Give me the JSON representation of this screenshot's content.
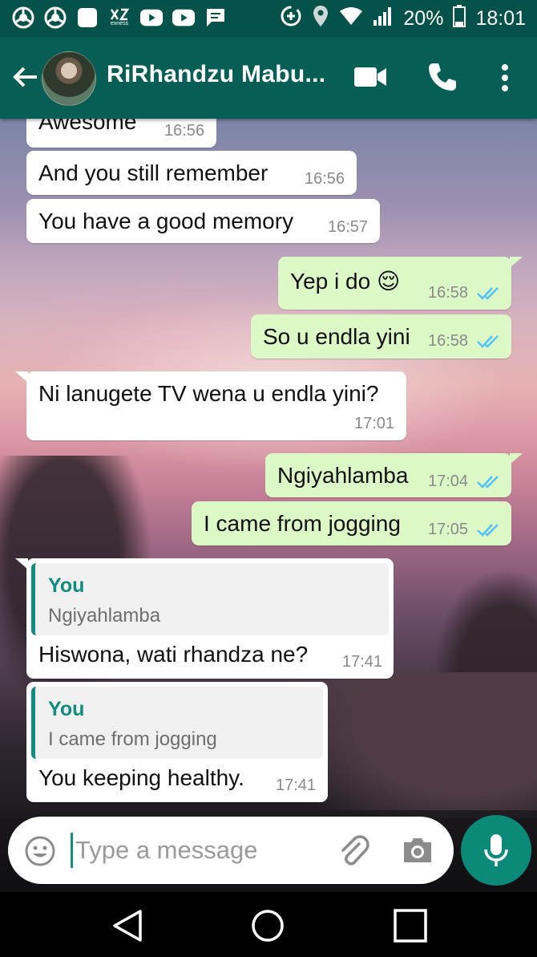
{
  "status_bar": {
    "battery": "20%",
    "time": "18:01",
    "left_icons": [
      "chrome-icon",
      "chrome-icon",
      "app-icon",
      "express-icon",
      "youtube-icon",
      "youtube-icon",
      "message-icon"
    ],
    "express_label": "exness"
  },
  "header": {
    "contact_name": "RiRhandzu Mabu...",
    "colors": {
      "header_bg": "#075e54",
      "status_bg": "#04524a"
    }
  },
  "messages": [
    {
      "id": 0,
      "direction": "in",
      "text": "Awesome",
      "time": "16:56"
    },
    {
      "id": 1,
      "direction": "in",
      "text": "And you still remember",
      "time": "16:56"
    },
    {
      "id": 2,
      "direction": "in",
      "text": "You have a good memory",
      "time": "16:57"
    },
    {
      "id": 3,
      "direction": "out",
      "text": "Yep i do 😌",
      "time": "16:58",
      "status": "read"
    },
    {
      "id": 4,
      "direction": "out",
      "text": "So u endla yini",
      "time": "16:58",
      "status": "read"
    },
    {
      "id": 5,
      "direction": "in",
      "text": "Ni lanugete TV wena u endla yini?",
      "time": "17:01"
    },
    {
      "id": 6,
      "direction": "out",
      "text": "Ngiyahlamba",
      "time": "17:04",
      "status": "read"
    },
    {
      "id": 7,
      "direction": "out",
      "text": "I came from jogging",
      "time": "17:05",
      "status": "read"
    },
    {
      "id": 8,
      "direction": "in",
      "text": "Hiswona, wati rhandza ne?",
      "time": "17:41",
      "quote": {
        "author": "You",
        "text": "Ngiyahlamba"
      }
    },
    {
      "id": 9,
      "direction": "in",
      "text": "You keeping healthy.",
      "time": "17:41",
      "quote": {
        "author": "You",
        "text": "I came from jogging"
      }
    }
  ],
  "composer": {
    "placeholder": "Type a message"
  },
  "colors": {
    "incoming_bubble": "#ffffff",
    "outgoing_bubble": "#dcf8c6",
    "read_ticks": "#4fc3f7",
    "accent": "#128c7e"
  }
}
